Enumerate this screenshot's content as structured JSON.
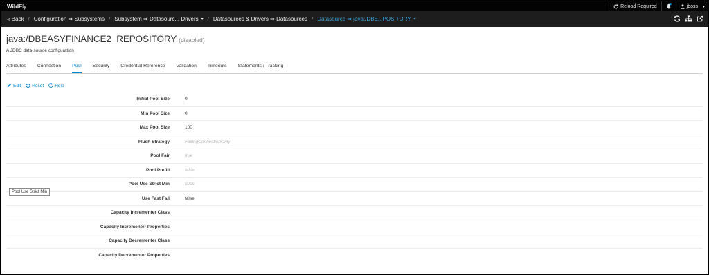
{
  "topbar": {
    "brand_bold": "Wild",
    "brand_rest": "Fly",
    "reload": "Reload Required",
    "user": "jboss"
  },
  "breadcrumb": {
    "back": "« Back",
    "items": [
      {
        "label": "Configuration ⇒ Subsystems"
      },
      {
        "label": "Subsystem ⇒ Datasourc... Drivers"
      },
      {
        "label": "Datasources & Drivers ⇒ Datasources"
      },
      {
        "label": "Datasource ⇒ java:/DBE...POSITORY"
      }
    ]
  },
  "page": {
    "title": "java:/DBEASYFINANCE2_REPOSITORY",
    "status": "(disabled)",
    "subtitle": "A JDBC data-source configuration"
  },
  "tabs": [
    {
      "label": "Attributes"
    },
    {
      "label": "Connection"
    },
    {
      "label": "Pool"
    },
    {
      "label": "Security"
    },
    {
      "label": "Credential Reference"
    },
    {
      "label": "Validation"
    },
    {
      "label": "Timeouts"
    },
    {
      "label": "Statements / Tracking"
    }
  ],
  "active_tab": "Pool",
  "toolbar": {
    "edit": "Edit",
    "reset": "Reset",
    "help": "Help"
  },
  "attributes": [
    {
      "label": "Initial Pool Size",
      "value": "0"
    },
    {
      "label": "Min Pool Size",
      "value": "0"
    },
    {
      "label": "Max Pool Size",
      "value": "100"
    },
    {
      "label": "Flush Strategy",
      "value": "FailingConnectionOnly"
    },
    {
      "label": "Pool Fair",
      "value": "true"
    },
    {
      "label": "Pool Prefill",
      "value": "false"
    },
    {
      "label": "Pool Use Strict Min",
      "value": "false"
    },
    {
      "label": "Use Fast Fail",
      "value": "false"
    },
    {
      "label": "Capacity Incrementer Class",
      "value": ""
    },
    {
      "label": "Capacity Incrementer Properties",
      "value": ""
    },
    {
      "label": "Capacity Decrementer Class",
      "value": ""
    },
    {
      "label": "Capacity Decrementer Properties",
      "value": ""
    }
  ],
  "tooltip": "Pool Use Strict Min",
  "colors": {
    "accent": "#0088ce",
    "breadcrumb_active": "#39a5dc",
    "topbar_bg": "#030303",
    "crumbbar_bg": "#1d1d1d"
  },
  "icons": {
    "reload": "refresh-icon",
    "notifications": "bell-icon",
    "user": "user-icon",
    "crumb_right": [
      "refresh-icon",
      "sitemap-icon",
      "external-link-icon"
    ]
  }
}
